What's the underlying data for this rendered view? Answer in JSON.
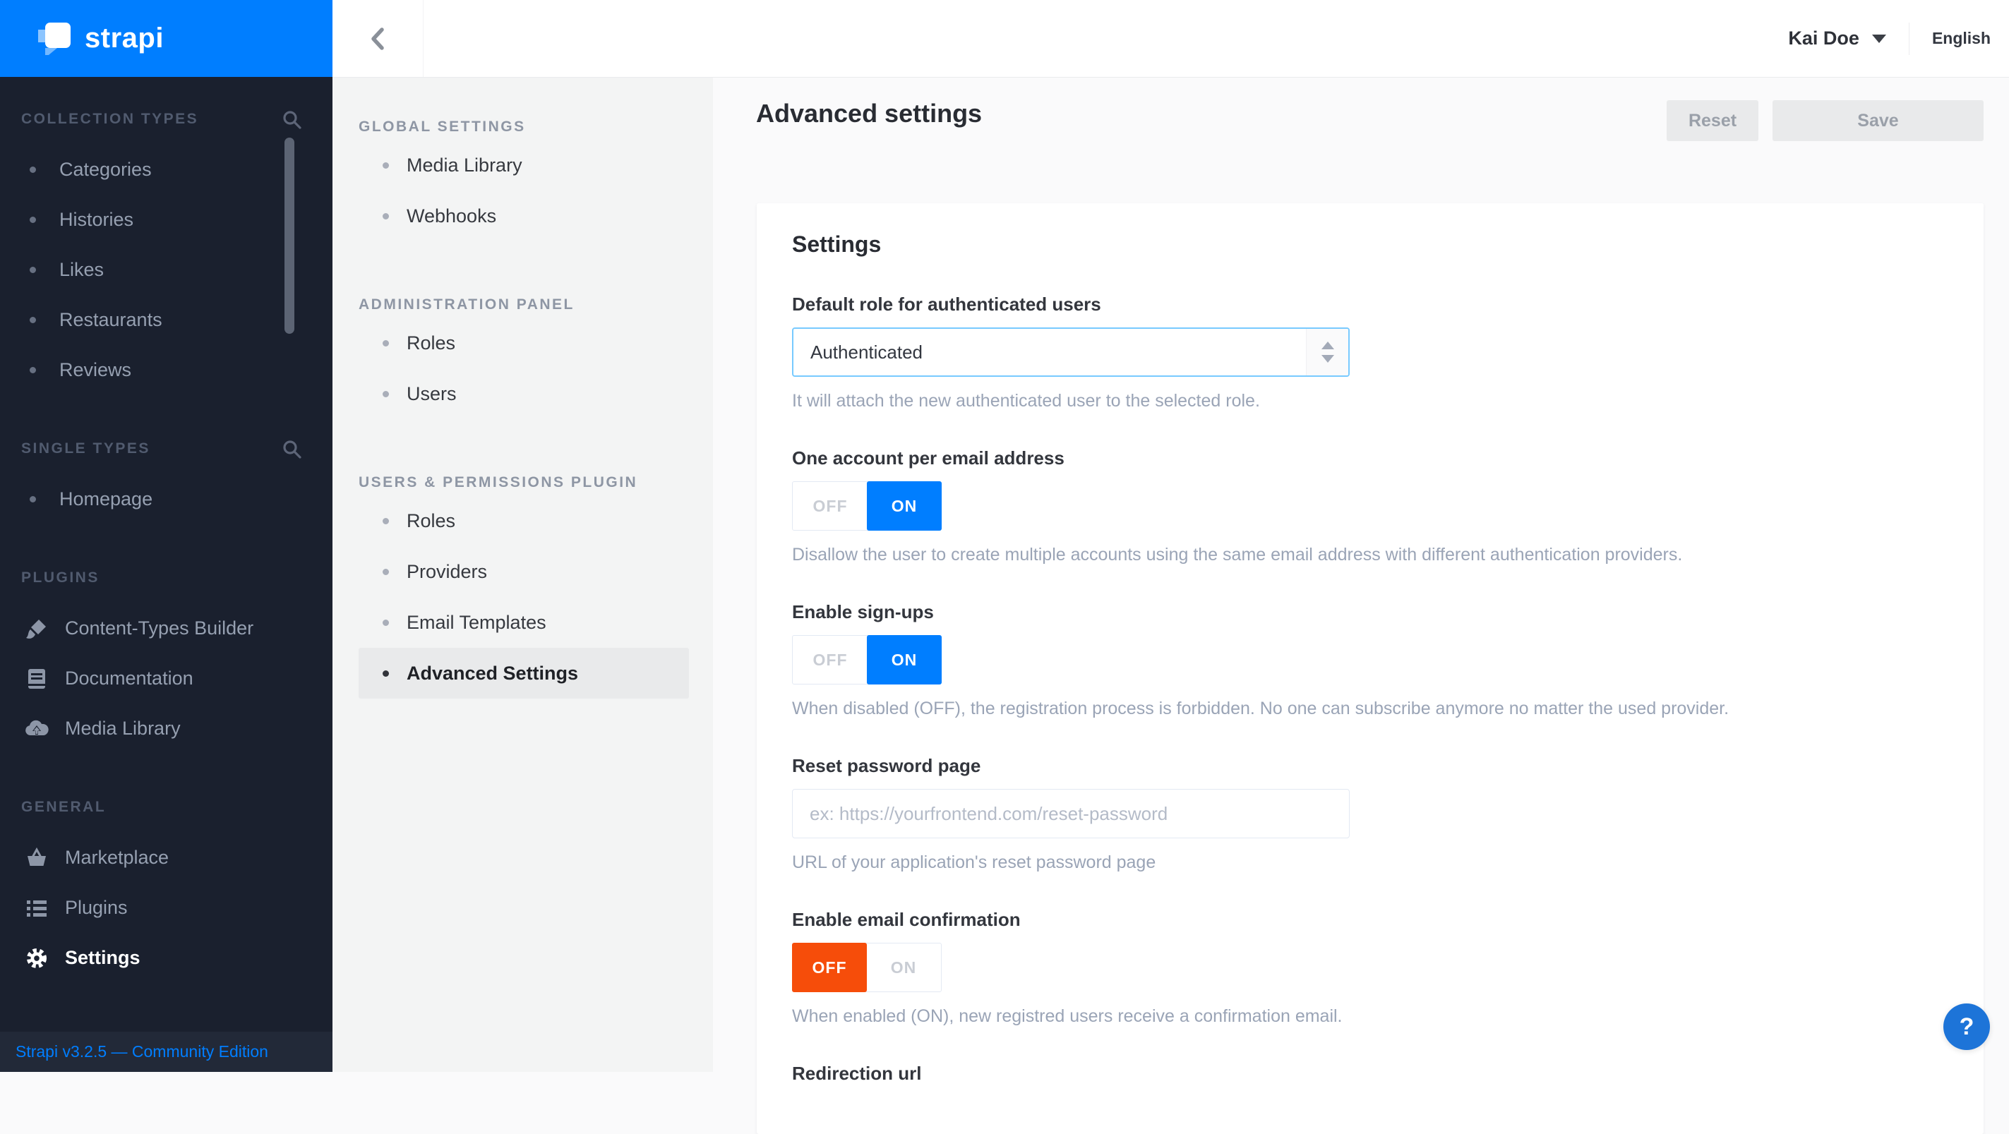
{
  "app": {
    "logo_text": "strapi",
    "footer_version": "Strapi v3.2.5 — Community Edition",
    "help_label": "?"
  },
  "colors": {
    "accent_blue": "#007eff",
    "toggle_off_active_orange": "#f64d0a",
    "sidebar_bg": "#1a202e",
    "subnav_bg": "#f3f4f4",
    "main_bg": "#fafafb",
    "select_focus_border": "#78caff"
  },
  "icons": {
    "search": "magnifier",
    "back": "chevron-left",
    "user_caret": "triangle-down",
    "content_types_builder": "paintbrush",
    "documentation": "book",
    "media_library": "cloud-upload",
    "marketplace": "basket",
    "plugins": "list",
    "settings": "gear",
    "help": "question-mark"
  },
  "topbar": {
    "user_name": "Kai Doe",
    "language": "English"
  },
  "left_nav": {
    "sections": [
      {
        "label": "COLLECTION TYPES",
        "items": [
          "Categories",
          "Histories",
          "Likes",
          "Restaurants",
          "Reviews"
        ]
      },
      {
        "label": "SINGLE TYPES",
        "items": [
          "Homepage"
        ]
      },
      {
        "label": "PLUGINS",
        "items": [
          "Content-Types Builder",
          "Documentation",
          "Media Library"
        ]
      },
      {
        "label": "GENERAL",
        "items": [
          "Marketplace",
          "Plugins",
          "Settings"
        ]
      }
    ],
    "active_item": "Settings"
  },
  "settings_nav": {
    "sections": [
      {
        "label": "GLOBAL SETTINGS",
        "items": [
          "Media Library",
          "Webhooks"
        ]
      },
      {
        "label": "ADMINISTRATION PANEL",
        "items": [
          "Roles",
          "Users"
        ]
      },
      {
        "label": "USERS & PERMISSIONS PLUGIN",
        "items": [
          "Roles",
          "Providers",
          "Email Templates",
          "Advanced Settings"
        ]
      }
    ],
    "active_item": "Advanced Settings"
  },
  "page": {
    "title": "Advanced settings",
    "actions": {
      "reset": "Reset",
      "save": "Save"
    },
    "card_title": "Settings",
    "fields": {
      "default_role": {
        "label": "Default role for authenticated users",
        "value": "Authenticated",
        "help": "It will attach the new authenticated user to the selected role."
      },
      "unique_email": {
        "label": "One account per email address",
        "off": "OFF",
        "on": "ON",
        "state": "on",
        "help": "Disallow the user to create multiple accounts using the same email address with different authentication providers."
      },
      "sign_ups": {
        "label": "Enable sign-ups",
        "off": "OFF",
        "on": "ON",
        "state": "on",
        "help": "When disabled (OFF), the registration process is forbidden. No one can subscribe anymore no matter the used provider."
      },
      "reset_password_page": {
        "label": "Reset password page",
        "value": "",
        "placeholder": "ex: https://yourfrontend.com/reset-password",
        "help": "URL of your application's reset password page"
      },
      "email_confirmation": {
        "label": "Enable email confirmation",
        "off": "OFF",
        "on": "ON",
        "state": "off",
        "help": "When enabled (ON), new registred users receive a confirmation email."
      },
      "redirection_url": {
        "label": "Redirection url"
      }
    }
  }
}
